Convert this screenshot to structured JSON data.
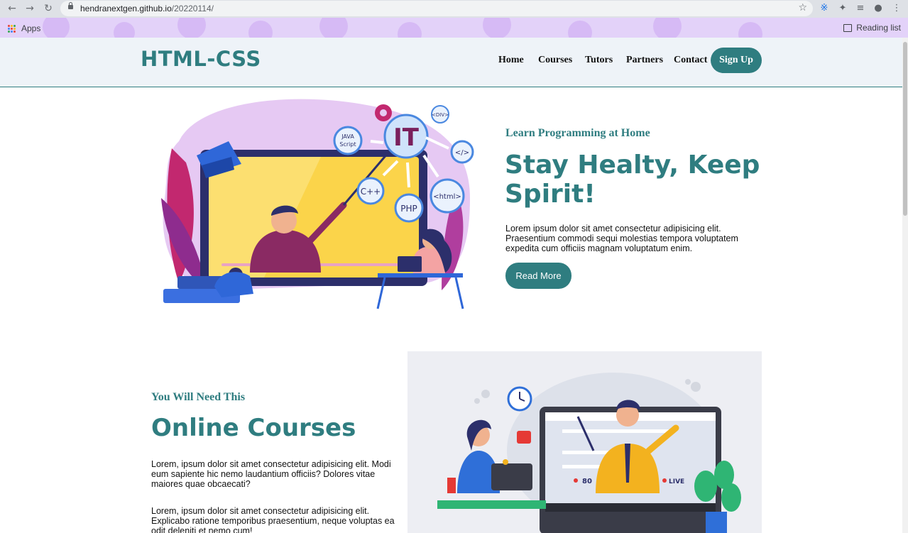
{
  "browser": {
    "url_host": "hendranextgen.github.io",
    "url_path": "/20220114/",
    "bookmarks": {
      "apps_label": "Apps",
      "reading_list_label": "Reading list"
    }
  },
  "site": {
    "logo": "HTML-CSS",
    "nav": [
      "Home",
      "Courses",
      "Tutors",
      "Partners",
      "Contact"
    ],
    "signup_label": "Sign Up"
  },
  "hero": {
    "eyebrow": "Learn Programming at Home",
    "title_line1": "Stay Healty, Keep",
    "title_line2": "Spirit!",
    "paragraph_lines": [
      "Lorem ipsum dolor sit amet consectetur adipisicing elit.",
      "Praesentium commodi sequi molestias tempora voluptatem",
      "expedita cum officiis magnam voluptatum enim."
    ],
    "button_label": "Read More",
    "art_labels": {
      "it": "IT",
      "java_line1": "JAVA",
      "java_line2": "Script",
      "div": "<DIV>",
      "code": "</>",
      "cpp": "C++",
      "php": "PHP",
      "html": "<html>"
    }
  },
  "courses": {
    "eyebrow": "You Will Need This",
    "title": "Online Courses",
    "paragraph1_lines": [
      "Lorem, ipsum dolor sit amet consectetur adipisicing elit. Modi",
      "eum sapiente hic nemo laudantium officiis? Dolores vitae",
      "maiores quae obcaecati?"
    ],
    "paragraph2_lines": [
      "Lorem, ipsum dolor sit amet consectetur adipisicing elit.",
      "Explicabo ratione temporibus praesentium, neque voluptas ea",
      "odit deleniti et nemo cum!"
    ],
    "art_labels": {
      "viewers": "80",
      "live": "LIVE"
    }
  },
  "colors": {
    "primary": "#2f7d80",
    "header_bg": "#eef3f8",
    "bookmarks_bg": "#e3d2f9"
  }
}
